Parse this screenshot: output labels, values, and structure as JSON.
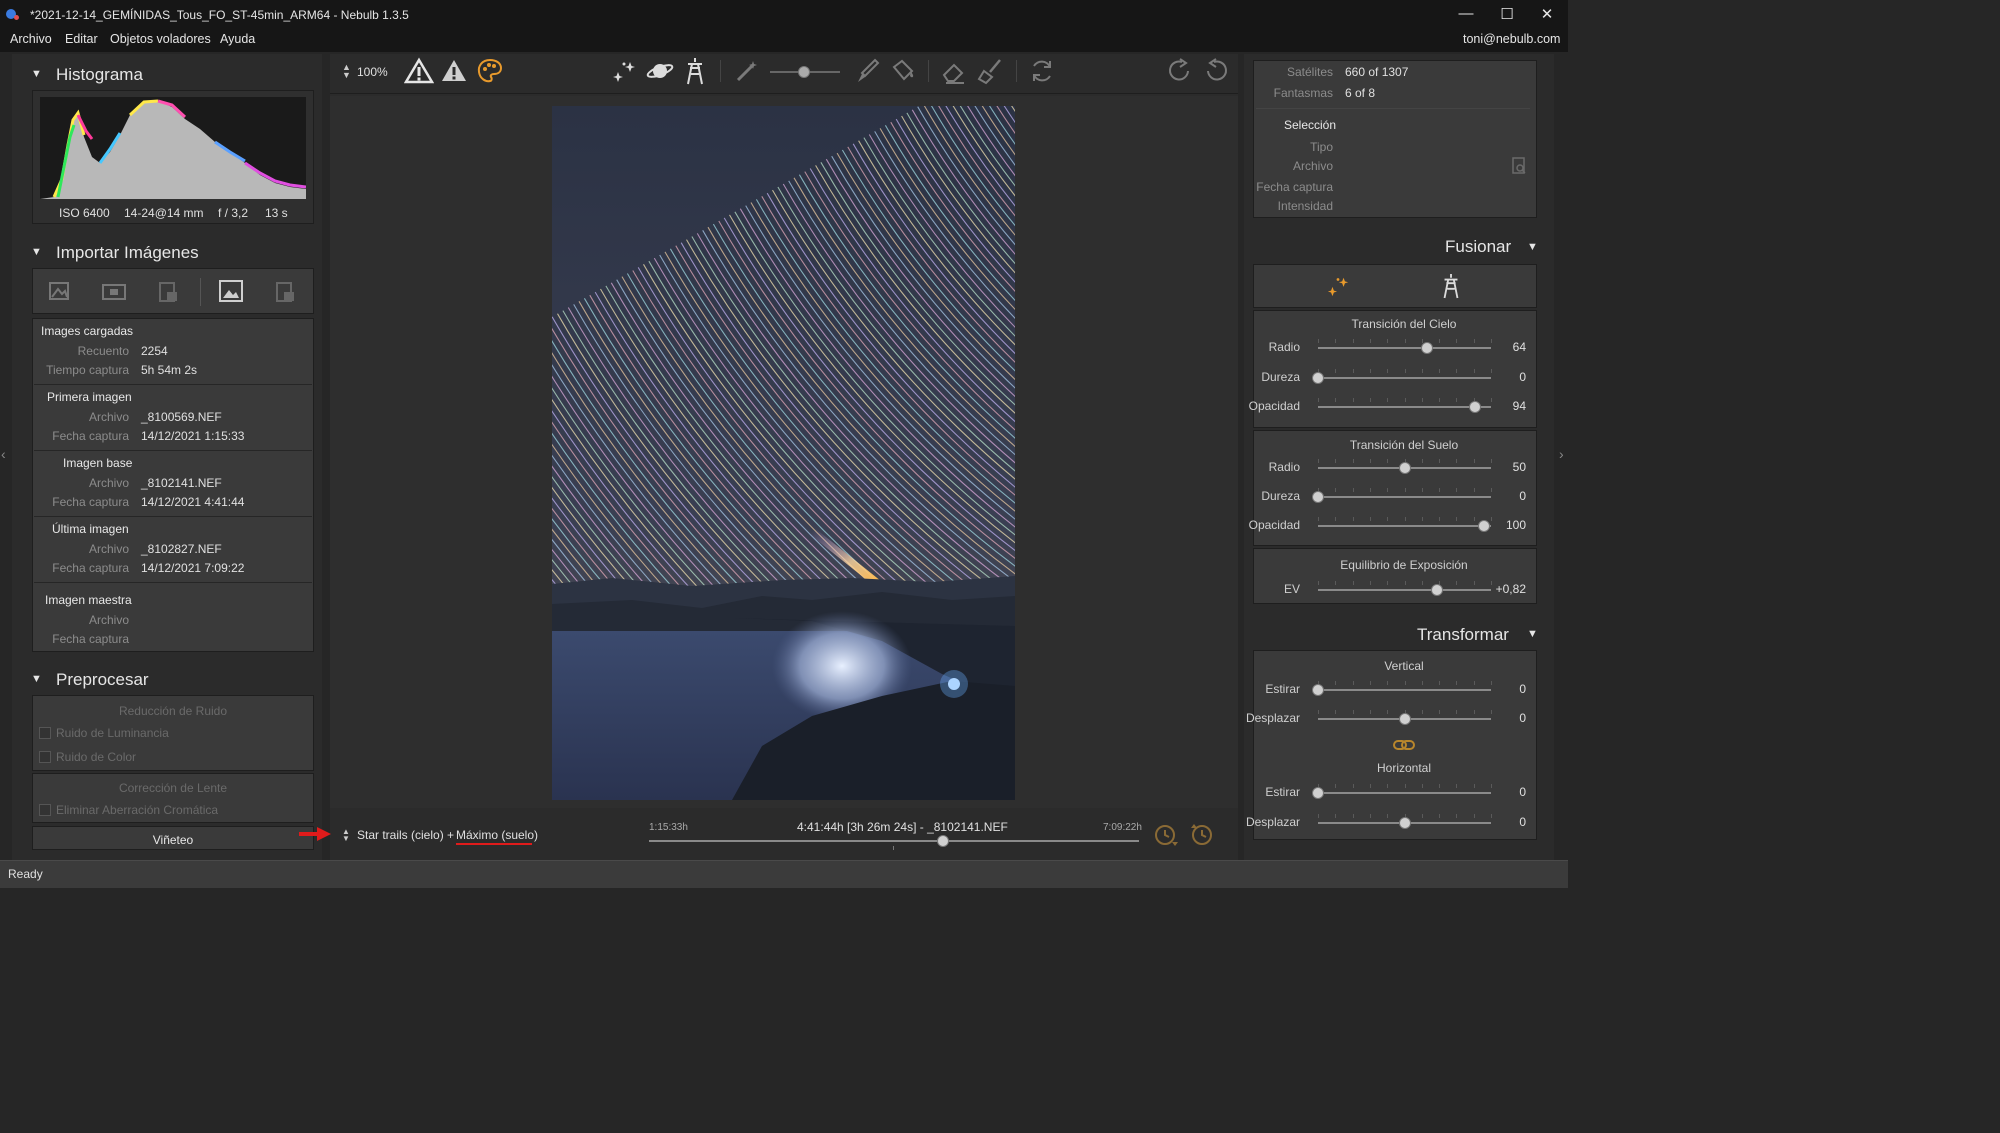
{
  "window": {
    "title": "*2021-12-14_GEMÍNIDAS_Tous_FO_ST-45min_ARM64 - Nebulb 1.3.5",
    "controls": {
      "minimize": "—",
      "maximize": "☐",
      "close": "✕"
    }
  },
  "menu": {
    "items": [
      "Archivo",
      "Editar",
      "Objetos voladores",
      "Ayuda"
    ],
    "user": "toni@nebulb.com"
  },
  "toolbar": {
    "zoom": "100%"
  },
  "histogram": {
    "title": "Histograma",
    "iso": "ISO 6400",
    "lens": "14-24@14 mm",
    "aperture": "f / 3,2",
    "exposure": "13 s"
  },
  "import": {
    "title": "Importar Imágenes",
    "loaded": {
      "header": "Images cargadas",
      "count_label": "Recuento",
      "count": "2254",
      "time_label": "Tiempo captura",
      "time": "5h 54m 2s"
    },
    "first": {
      "header": "Primera imagen",
      "file_label": "Archivo",
      "file": "_8100569.NEF",
      "date_label": "Fecha captura",
      "date": "14/12/2021 1:15:33"
    },
    "base": {
      "header": "Imagen base",
      "file_label": "Archivo",
      "file": "_8102141.NEF",
      "date_label": "Fecha captura",
      "date": "14/12/2021 4:41:44"
    },
    "last": {
      "header": "Última imagen",
      "file_label": "Archivo",
      "file": "_8102827.NEF",
      "date_label": "Fecha captura",
      "date": "14/12/2021 7:09:22"
    },
    "master": {
      "header": "Imagen maestra",
      "file_label": "Archivo",
      "date_label": "Fecha captura"
    }
  },
  "preprocess": {
    "title": "Preprocesar",
    "noise": {
      "header": "Reducción de Ruido",
      "lum": "Ruido de Luminancia",
      "color": "Ruido de Color"
    },
    "lens": {
      "header": "Corrección de Lente",
      "ca": "Eliminar Aberración Cromática"
    },
    "vignette": "Viñeteo"
  },
  "bottom": {
    "mode_a": "Star trails (cielo) + ",
    "mode_b": "Máximo (suelo)",
    "start": "1:15:33h",
    "current": "4:41:44h [3h 26m 24s] - _8102141.NEF",
    "end": "7:09:22h",
    "timeline_position": 0.6
  },
  "info": {
    "sat_label": "Satélites",
    "sat": "660 of 1307",
    "ghost_label": "Fantasmas",
    "ghost": "6 of 8",
    "selection": "Selección",
    "type": "Tipo",
    "file": "Archivo",
    "date": "Fecha captura",
    "intensity": "Intensidad"
  },
  "merge": {
    "title": "Fusionar",
    "sky": {
      "header": "Transición del Cielo",
      "radio": {
        "label": "Radio",
        "value": "64",
        "pos": 0.63
      },
      "dureza": {
        "label": "Dureza",
        "value": "0",
        "pos": 0.0
      },
      "opacidad": {
        "label": "Opacidad",
        "value": "94",
        "pos": 0.91
      }
    },
    "ground": {
      "header": "Transición del Suelo",
      "radio": {
        "label": "Radio",
        "value": "50",
        "pos": 0.5
      },
      "dureza": {
        "label": "Dureza",
        "value": "0",
        "pos": 0.0
      },
      "opacidad": {
        "label": "Opacidad",
        "value": "100",
        "pos": 0.96
      }
    },
    "ev": {
      "header": "Equilibrio de Exposición",
      "label": "EV",
      "value": "+0,82",
      "pos": 0.69
    }
  },
  "transform": {
    "title": "Transformar",
    "vertical": {
      "header": "Vertical",
      "stretch": {
        "label": "Estirar",
        "value": "0",
        "pos": 0.0
      },
      "shift": {
        "label": "Desplazar",
        "value": "0",
        "pos": 0.5
      }
    },
    "horizontal": {
      "header": "Horizontal",
      "stretch": {
        "label": "Estirar",
        "value": "0",
        "pos": 0.0
      },
      "shift": {
        "label": "Desplazar",
        "value": "0",
        "pos": 0.5
      }
    }
  },
  "status": "Ready",
  "colors": {
    "accent": "#e89a2c",
    "underline": "#e01b1b",
    "arrow": "#e01b1b"
  }
}
